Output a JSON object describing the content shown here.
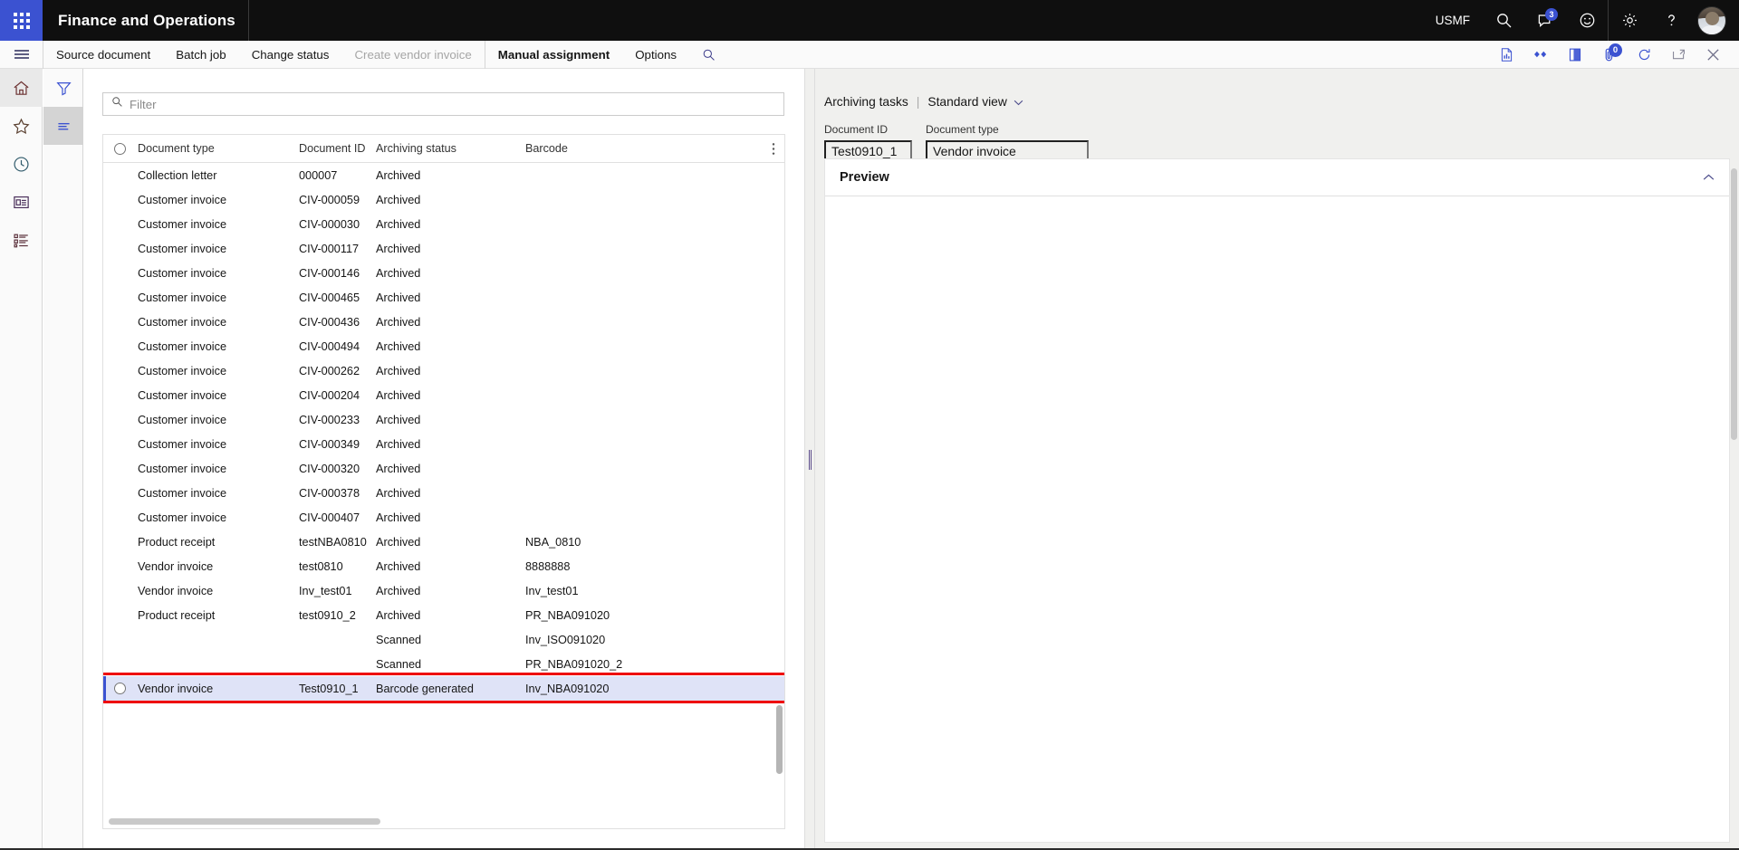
{
  "topbar": {
    "waffle_icon": "app-launcher-icon",
    "app_title": "Finance and Operations",
    "company": "USMF",
    "icons": [
      {
        "name": "search-icon",
        "label": "Search"
      },
      {
        "name": "notifications-icon",
        "label": "Notifications",
        "badge": "3"
      },
      {
        "name": "feedback-smiley-icon",
        "label": "Feedback"
      },
      {
        "name": "settings-gear-icon",
        "label": "Settings"
      },
      {
        "name": "help-question-icon",
        "label": "Help"
      }
    ],
    "avatar": "user-avatar"
  },
  "action_pane": {
    "hamburger_icon": "hamburger-menu-icon",
    "tabs": [
      {
        "label": "Source document",
        "state": "normal"
      },
      {
        "label": "Batch job",
        "state": "normal"
      },
      {
        "label": "Change status",
        "state": "normal"
      },
      {
        "label": "Create vendor invoice",
        "state": "disabled"
      },
      {
        "label": "Manual assignment",
        "state": "active"
      },
      {
        "label": "Options",
        "state": "normal"
      }
    ],
    "search_icon": "action-pane-search-icon",
    "right_icons": [
      {
        "name": "report-document-icon",
        "label": "Report"
      },
      {
        "name": "relations-link-icon",
        "label": "Relations"
      },
      {
        "name": "office-app-icon",
        "label": "Open in Office"
      },
      {
        "name": "attachment-icon",
        "label": "Attachments",
        "badge": "0"
      },
      {
        "name": "refresh-icon",
        "label": "Refresh"
      },
      {
        "name": "popout-window-icon",
        "label": "Open in new window"
      },
      {
        "name": "close-icon",
        "label": "Close"
      }
    ]
  },
  "nav_rail": {
    "items": [
      {
        "name": "home-icon",
        "label": "Home",
        "selected": true
      },
      {
        "name": "favorites-star-icon",
        "label": "Favorites",
        "selected": false
      },
      {
        "name": "recent-clock-icon",
        "label": "Recent",
        "selected": false
      },
      {
        "name": "workspaces-icon",
        "label": "Workspaces",
        "selected": false
      },
      {
        "name": "modules-list-icon",
        "label": "Modules",
        "selected": false
      }
    ]
  },
  "view_rail": {
    "items": [
      {
        "name": "filter-funnel-icon",
        "label": "Filter",
        "selected": false
      },
      {
        "name": "list-view-icon",
        "label": "List view",
        "selected": true
      }
    ]
  },
  "filter": {
    "icon": "search-icon",
    "placeholder": "Filter",
    "value": ""
  },
  "grid": {
    "select_all_icon": "select-all-circle",
    "overflow_icon": "column-options-icon",
    "columns": [
      "Document type",
      "Document ID",
      "Archiving status",
      "Barcode"
    ],
    "rows": [
      {
        "document_type": "Collection letter",
        "document_id": "000007",
        "archiving_status": "Archived",
        "barcode": "",
        "selected": false
      },
      {
        "document_type": "Customer invoice",
        "document_id": "CIV-000059",
        "archiving_status": "Archived",
        "barcode": "",
        "selected": false
      },
      {
        "document_type": "Customer invoice",
        "document_id": "CIV-000030",
        "archiving_status": "Archived",
        "barcode": "",
        "selected": false
      },
      {
        "document_type": "Customer invoice",
        "document_id": "CIV-000117",
        "archiving_status": "Archived",
        "barcode": "",
        "selected": false
      },
      {
        "document_type": "Customer invoice",
        "document_id": "CIV-000146",
        "archiving_status": "Archived",
        "barcode": "",
        "selected": false
      },
      {
        "document_type": "Customer invoice",
        "document_id": "CIV-000465",
        "archiving_status": "Archived",
        "barcode": "",
        "selected": false
      },
      {
        "document_type": "Customer invoice",
        "document_id": "CIV-000436",
        "archiving_status": "Archived",
        "barcode": "",
        "selected": false
      },
      {
        "document_type": "Customer invoice",
        "document_id": "CIV-000494",
        "archiving_status": "Archived",
        "barcode": "",
        "selected": false
      },
      {
        "document_type": "Customer invoice",
        "document_id": "CIV-000262",
        "archiving_status": "Archived",
        "barcode": "",
        "selected": false
      },
      {
        "document_type": "Customer invoice",
        "document_id": "CIV-000204",
        "archiving_status": "Archived",
        "barcode": "",
        "selected": false
      },
      {
        "document_type": "Customer invoice",
        "document_id": "CIV-000233",
        "archiving_status": "Archived",
        "barcode": "",
        "selected": false
      },
      {
        "document_type": "Customer invoice",
        "document_id": "CIV-000349",
        "archiving_status": "Archived",
        "barcode": "",
        "selected": false
      },
      {
        "document_type": "Customer invoice",
        "document_id": "CIV-000320",
        "archiving_status": "Archived",
        "barcode": "",
        "selected": false
      },
      {
        "document_type": "Customer invoice",
        "document_id": "CIV-000378",
        "archiving_status": "Archived",
        "barcode": "",
        "selected": false
      },
      {
        "document_type": "Customer invoice",
        "document_id": "CIV-000407",
        "archiving_status": "Archived",
        "barcode": "",
        "selected": false
      },
      {
        "document_type": "Product receipt",
        "document_id": "testNBA0810",
        "archiving_status": "Archived",
        "barcode": "NBA_0810",
        "selected": false
      },
      {
        "document_type": "Vendor invoice",
        "document_id": "test0810",
        "archiving_status": "Archived",
        "barcode": "8888888",
        "selected": false
      },
      {
        "document_type": "Vendor invoice",
        "document_id": "Inv_test01",
        "archiving_status": "Archived",
        "barcode": "Inv_test01",
        "selected": false
      },
      {
        "document_type": "Product receipt",
        "document_id": "test0910_2",
        "archiving_status": "Archived",
        "barcode": "PR_NBA091020",
        "selected": false
      },
      {
        "document_type": "",
        "document_id": "",
        "archiving_status": "Scanned",
        "barcode": "Inv_ISO091020",
        "selected": false
      },
      {
        "document_type": "",
        "document_id": "",
        "archiving_status": "Scanned",
        "barcode": "PR_NBA091020_2",
        "selected": false
      },
      {
        "document_type": "Vendor invoice",
        "document_id": "Test0910_1",
        "archiving_status": "Barcode generated",
        "barcode": "Inv_NBA091020",
        "selected": true
      }
    ]
  },
  "right_pane": {
    "breadcrumb": "Archiving tasks",
    "separator": "|",
    "view_name": "Standard view",
    "view_chevron_icon": "chevron-down-icon",
    "fields": [
      {
        "label": "Document ID",
        "value": "Test0910_1"
      },
      {
        "label": "Document type",
        "value": "Vendor invoice"
      }
    ],
    "preview": {
      "title": "Preview",
      "collapse_icon": "chevron-up-icon",
      "content": ""
    }
  },
  "colors": {
    "accent": "#3b52d1",
    "topbar_bg": "#0f0f0f",
    "selected_row": "#dfe3f7",
    "annotation_red": "#ee0000",
    "pane_bg": "#f0f0ee"
  }
}
